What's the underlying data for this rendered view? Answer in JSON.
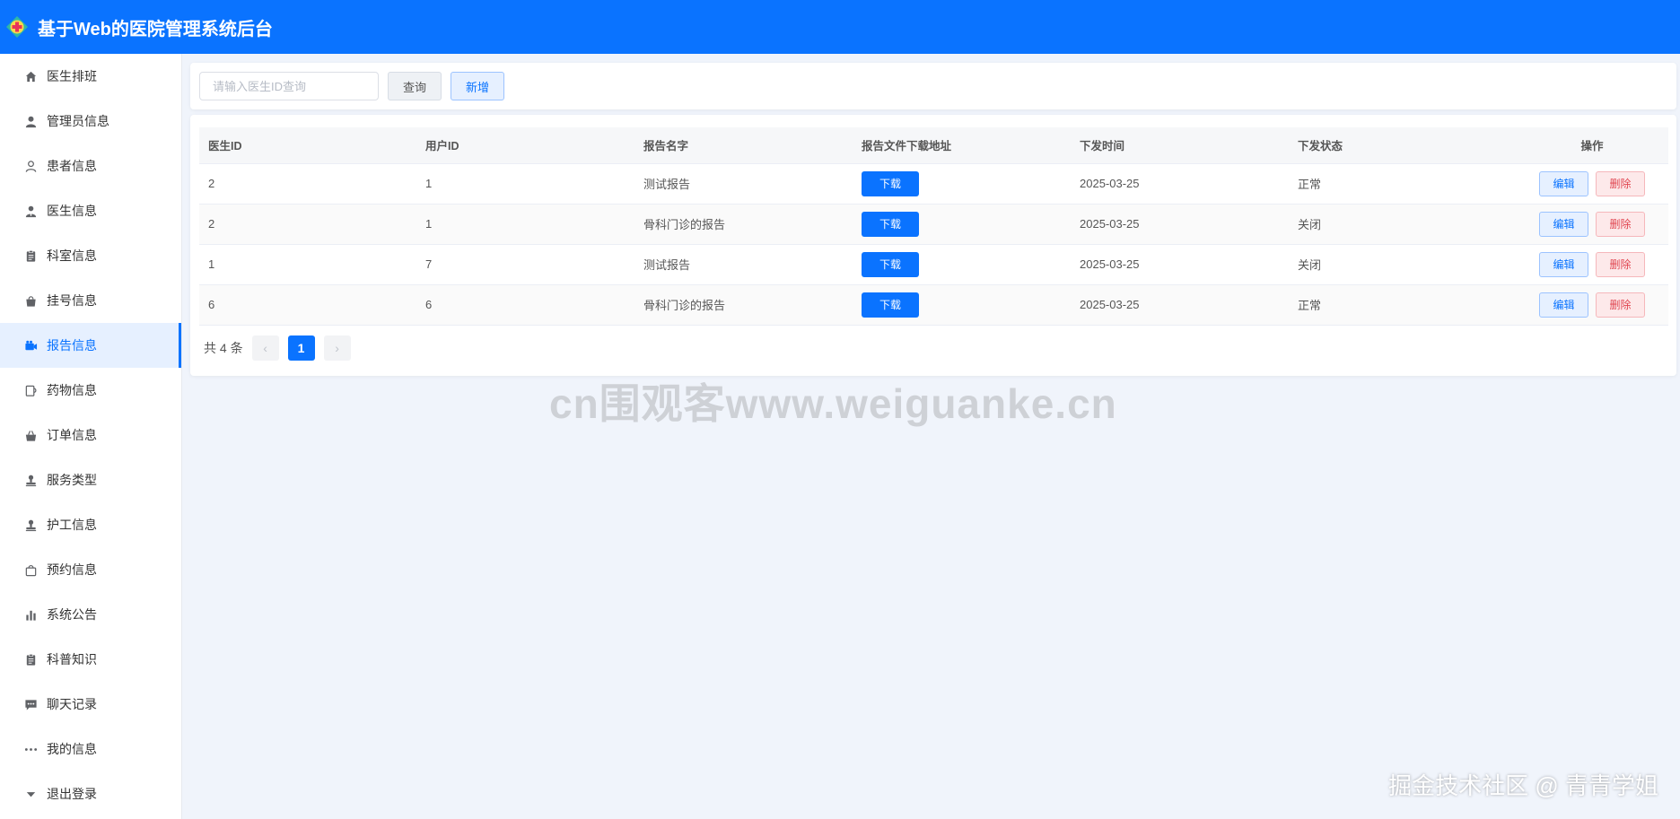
{
  "app": {
    "title": "基于Web的医院管理系统后台"
  },
  "sidebar": {
    "items": [
      {
        "label": "医生排班",
        "icon": "home-icon"
      },
      {
        "label": "管理员信息",
        "icon": "user-icon"
      },
      {
        "label": "患者信息",
        "icon": "user-outline-icon"
      },
      {
        "label": "医生信息",
        "icon": "doctor-icon"
      },
      {
        "label": "科室信息",
        "icon": "clipboard-icon"
      },
      {
        "label": "挂号信息",
        "icon": "bag-icon"
      },
      {
        "label": "报告信息",
        "icon": "camera-icon",
        "active": true
      },
      {
        "label": "药物信息",
        "icon": "cup-icon"
      },
      {
        "label": "订单信息",
        "icon": "basket-icon"
      },
      {
        "label": "服务类型",
        "icon": "stamp-icon"
      },
      {
        "label": "护工信息",
        "icon": "stamp-icon"
      },
      {
        "label": "预约信息",
        "icon": "shopping-bag-icon"
      },
      {
        "label": "系统公告",
        "icon": "bar-chart-icon"
      },
      {
        "label": "科普知识",
        "icon": "clipboard-icon"
      },
      {
        "label": "聊天记录",
        "icon": "chat-icon"
      },
      {
        "label": "我的信息",
        "icon": "more-icon"
      },
      {
        "label": "退出登录",
        "icon": "caret-down-icon"
      }
    ]
  },
  "search": {
    "placeholder": "请输入医生ID查询",
    "query_label": "查询",
    "add_label": "新增"
  },
  "table": {
    "columns": [
      "医生ID",
      "用户ID",
      "报告名字",
      "报告文件下载地址",
      "下发时间",
      "下发状态",
      "操作"
    ],
    "rows": [
      {
        "doctor_id": "2",
        "user_id": "1",
        "name": "测试报告",
        "download": "下载",
        "time": "2025-03-25",
        "status": "正常",
        "edit": "编辑",
        "delete": "删除"
      },
      {
        "doctor_id": "2",
        "user_id": "1",
        "name": "骨科门诊的报告",
        "download": "下载",
        "time": "2025-03-25",
        "status": "关闭",
        "edit": "编辑",
        "delete": "删除"
      },
      {
        "doctor_id": "1",
        "user_id": "7",
        "name": "测试报告",
        "download": "下载",
        "time": "2025-03-25",
        "status": "关闭",
        "edit": "编辑",
        "delete": "删除"
      },
      {
        "doctor_id": "6",
        "user_id": "6",
        "name": "骨科门诊的报告",
        "download": "下载",
        "time": "2025-03-25",
        "status": "正常",
        "edit": "编辑",
        "delete": "删除"
      }
    ]
  },
  "pagination": {
    "total_label": "共 4 条",
    "current_page": "1",
    "prev_symbol": "‹",
    "next_symbol": "›"
  },
  "watermarks": {
    "center": "cn围观客www.weiguanke.cn",
    "corner": "掘金技术社区 @ 青青学姐"
  },
  "colors": {
    "primary": "#0a73ff",
    "danger": "#e0444f",
    "background": "#f0f4fb"
  }
}
